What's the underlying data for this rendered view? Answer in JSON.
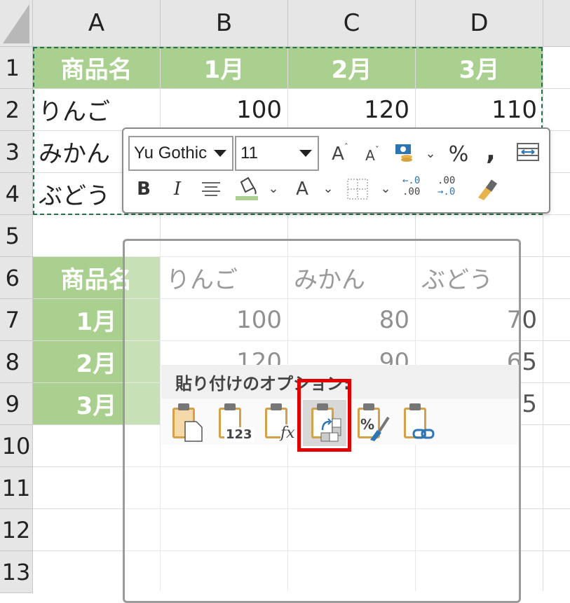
{
  "columns": [
    "A",
    "B",
    "C",
    "D"
  ],
  "rows": [
    "1",
    "2",
    "3",
    "4",
    "5",
    "6",
    "7",
    "8",
    "9",
    "10",
    "11",
    "12",
    "13"
  ],
  "table1": {
    "header": [
      "商品名",
      "1月",
      "2月",
      "3月"
    ],
    "rows": [
      [
        "りんご",
        "100",
        "120",
        "110"
      ],
      [
        "みかん",
        "",
        "",
        ""
      ],
      [
        "ぶどう",
        "",
        "",
        ""
      ]
    ]
  },
  "table2": {
    "header": [
      "商品名",
      "りんご",
      "みかん",
      "ぶどう"
    ],
    "rows": [
      [
        "1月",
        "100",
        "80",
        "70"
      ],
      [
        "2月",
        "120",
        "90",
        "65"
      ],
      [
        "3月",
        "",
        "",
        "75"
      ]
    ]
  },
  "mini_toolbar": {
    "font_name": "Yu Gothic",
    "font_size": "11",
    "percent": "%",
    "comma": ",",
    "bold": "B",
    "italic": "I",
    "font_color_letter": "A",
    "inc_decimal_top": "←.0",
    "inc_decimal_bottom": ".00",
    "dec_decimal_top": ".00",
    "dec_decimal_bottom": "→.0"
  },
  "paste_options": {
    "title": "貼り付けのオプション:",
    "buttons": [
      "paste",
      "paste-values",
      "paste-formulas",
      "paste-transpose",
      "paste-formatting",
      "paste-link"
    ],
    "value_icon_label": "123",
    "formula_icon_label": "fx"
  },
  "colors": {
    "header_green": "#a9d08e",
    "highlight_red": "#e00000",
    "clipboard": "#d4a04a"
  }
}
